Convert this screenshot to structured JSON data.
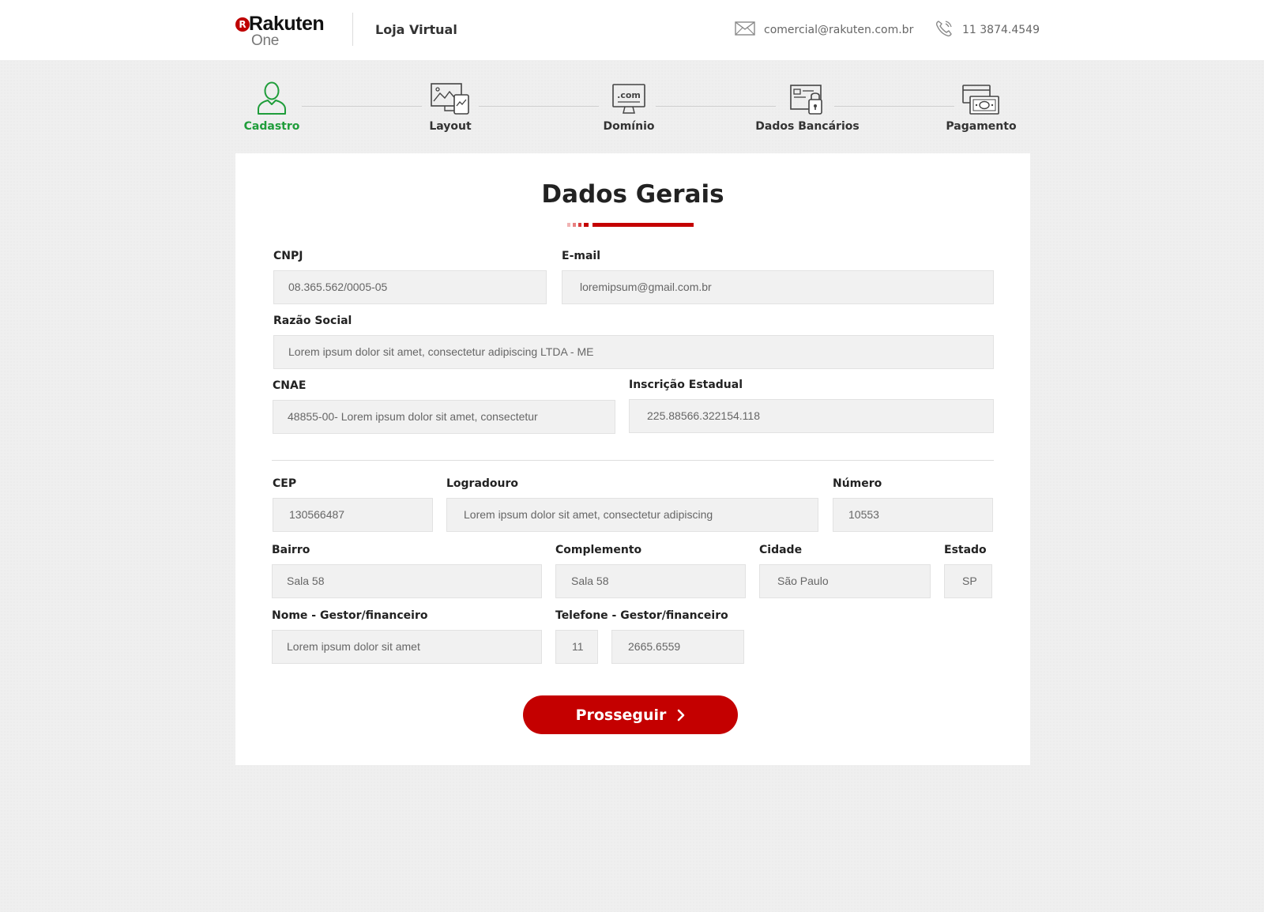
{
  "header": {
    "logo_mark": "R",
    "logo_word": "Rakuten",
    "logo_sub": "One",
    "title": "Loja Virtual",
    "email": "comercial@rakuten.com.br",
    "phone": "11 3874.4549",
    "email_icon": "envelope-icon",
    "phone_icon": "phone-icon"
  },
  "steps": [
    {
      "label": "Cadastro",
      "icon": "user-icon",
      "active": true
    },
    {
      "label": "Layout",
      "icon": "layout-devices-icon",
      "active": false
    },
    {
      "label": "Domínio",
      "icon": "domain-monitor-icon",
      "active": false
    },
    {
      "label": "Dados Bancários",
      "icon": "bank-lock-icon",
      "active": false
    },
    {
      "label": "Pagamento",
      "icon": "payment-card-icon",
      "active": false
    }
  ],
  "form": {
    "title": "Dados Gerais",
    "cnpj": {
      "label": "CNPJ",
      "value": "08.365.562/0005-05"
    },
    "email": {
      "label": "E-mail",
      "value": "loremipsum@gmail.com.br"
    },
    "razao_social": {
      "label": "Razão Social",
      "value": "Lorem ipsum dolor sit amet, consectetur adipiscing LTDA - ME"
    },
    "cnae": {
      "label": "CNAE",
      "value": "48855-00- Lorem ipsum dolor sit amet, consectetur"
    },
    "inscricao_estadual": {
      "label": "Inscrição Estadual",
      "value": "225.88566.322154.118"
    },
    "cep": {
      "label": "CEP",
      "value": "130566487"
    },
    "logradouro": {
      "label": "Logradouro",
      "value": "Lorem ipsum dolor sit amet, consectetur adipiscing"
    },
    "numero": {
      "label": "Número",
      "value": "10553"
    },
    "bairro": {
      "label": "Bairro",
      "value": "Sala 58"
    },
    "complemento": {
      "label": "Complemento",
      "value": "Sala 58"
    },
    "cidade": {
      "label": "Cidade",
      "value": "São Paulo"
    },
    "estado": {
      "label": "Estado",
      "value": "SP"
    },
    "nome_gestor": {
      "label": "Nome - Gestor/financeiro",
      "value": "Lorem ipsum dolor sit amet"
    },
    "telefone_gestor": {
      "label": "Telefone - Gestor/financeiro",
      "ddd": "11",
      "value": "2665.6559"
    },
    "submit_label": "Prosseguir"
  },
  "colors": {
    "accent": "#c40000",
    "active_step": "#1f9d3a"
  }
}
